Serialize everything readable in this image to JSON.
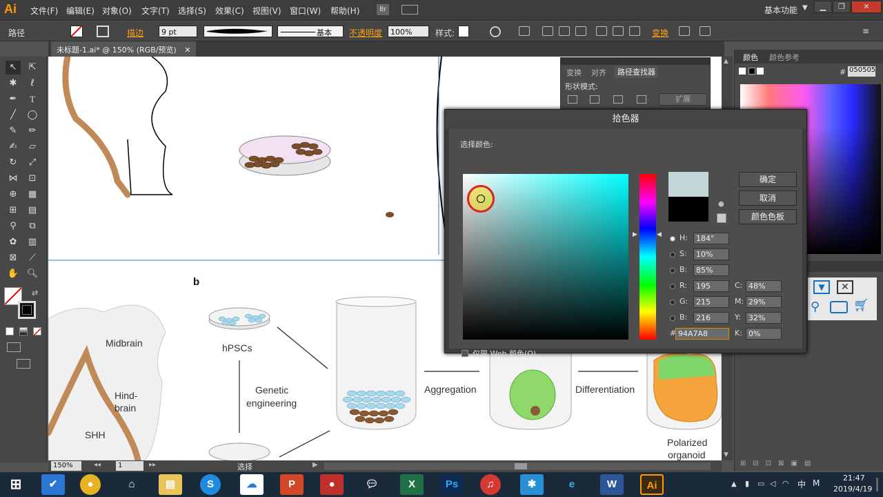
{
  "app": {
    "logo": "Ai",
    "workspace": "基本功能"
  },
  "menu": [
    "文件(F)",
    "编辑(E)",
    "对象(O)",
    "文字(T)",
    "选择(S)",
    "效果(C)",
    "视图(V)",
    "窗口(W)",
    "帮助(H)"
  ],
  "menu_extra": {
    "br_label": "Br"
  },
  "control": {
    "selection_type": "路径",
    "stroke_label": "描边",
    "stroke_weight": "9 pt",
    "profile_label": "基本",
    "opacity_label": "不透明度",
    "opacity_value": "100%",
    "style_label": "样式:",
    "transform_label": "变换"
  },
  "document": {
    "tab_title": "未标题-1.ai* @ 150% (RGB/预览)"
  },
  "canvas": {
    "panel_b": "b",
    "midbrain": "Midbrain",
    "hindbrain_1": "Hind-",
    "hindbrain_2": "brain",
    "shh": "SHH",
    "hpscs": "hPSCs",
    "genetic_1": "Genetic",
    "genetic_2": "engineering",
    "aggregation": "Aggregation",
    "differentiation": "Differentiation",
    "polarized_1": "Polarized",
    "polarized_2": "organoid"
  },
  "status": {
    "zoom": "150%",
    "artboard": "1",
    "tool": "选择"
  },
  "pathfinder": {
    "tabs": [
      "变换",
      "对齐",
      "路径查找器"
    ],
    "shape_modes": "形状模式:",
    "expand": "扩展"
  },
  "right_panel": {
    "tabs": [
      "颜色",
      "颜色参考"
    ],
    "hex": "050505"
  },
  "color_picker": {
    "title": "拾色器",
    "select_label": "选择颜色:",
    "ok": "确定",
    "cancel": "取消",
    "swatches": "颜色色板",
    "web_only": "仅限 Web 颜色(O)",
    "hsb": [
      {
        "label": "H:",
        "value": "184°"
      },
      {
        "label": "S:",
        "value": "10%"
      },
      {
        "label": "B:",
        "value": "85%"
      }
    ],
    "rgb": [
      {
        "label": "R:",
        "value": "195"
      },
      {
        "label": "G:",
        "value": "215"
      },
      {
        "label": "B:",
        "value": "216"
      }
    ],
    "cmyk": [
      {
        "label": "C:",
        "value": "48%"
      },
      {
        "label": "M:",
        "value": "29%"
      },
      {
        "label": "Y:",
        "value": "32%"
      },
      {
        "label": "K:",
        "value": "0%"
      }
    ],
    "hex": "94A7A8",
    "new_color": "#c3d7d8",
    "old_color": "#000000"
  },
  "taskbar": {
    "apps": [
      "windows-start",
      "flowchart-app",
      "chrome",
      "home",
      "file-explorer",
      "sogou",
      "baidu-netdisk",
      "powerpoint",
      "recorder",
      "wechat",
      "excel",
      "photoshop",
      "netease-music",
      "star-app",
      "internet-explorer",
      "word",
      "illustrator"
    ],
    "ime": "中",
    "ime2": "M",
    "time": "21:47",
    "date": "2019/4/19"
  }
}
